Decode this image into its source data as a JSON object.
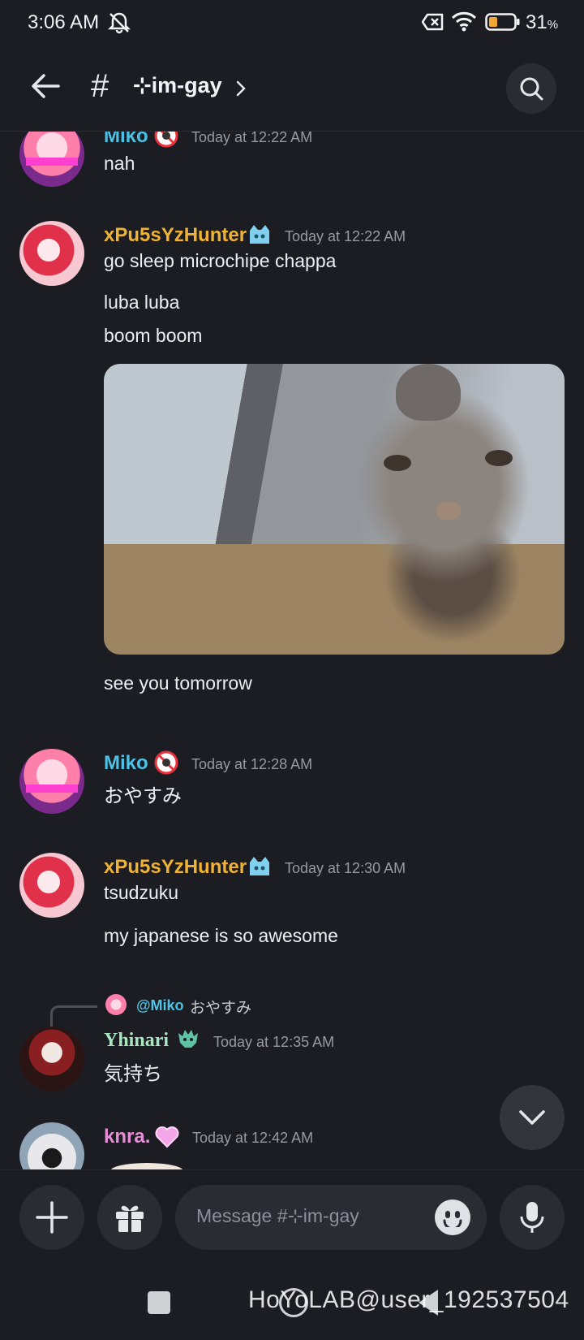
{
  "status_bar": {
    "time": "3:06 AM",
    "battery_pct": "31",
    "battery_unit": "%"
  },
  "header": {
    "hash": "#",
    "channel_name": "⊹im-gay",
    "chevron": "›"
  },
  "messages": [
    {
      "author": "Miko",
      "author_color": "#4cc3e6",
      "timestamp": "Today at 12:22 AM",
      "lines": [
        "nah"
      ]
    },
    {
      "author": "xPu5sYzHunter",
      "author_color": "#f0b232",
      "timestamp": "Today at 12:22 AM",
      "lines": [
        "go sleep microchipe chappa",
        "luba luba",
        "boom boom",
        "see you tomorrow"
      ]
    },
    {
      "author": "Miko",
      "author_color": "#4cc3e6",
      "timestamp": "Today at 12:28 AM",
      "lines": [
        "おやすみ"
      ]
    },
    {
      "author": "xPu5sYzHunter",
      "author_color": "#f0b232",
      "timestamp": "Today at 12:30 AM",
      "lines": [
        "tsudzuku",
        "my japanese is so awesome"
      ]
    },
    {
      "reply_to": "@Miko",
      "reply_text": "おやすみ",
      "author": "Yhinari",
      "author_color": "#a9e6c0",
      "timestamp": "Today at 12:35 AM",
      "lines": [
        "気持ち"
      ]
    },
    {
      "author": "knra.",
      "author_color": "#e58fd6",
      "timestamp": "Today at 12:42 AM",
      "lines": []
    }
  ],
  "composer": {
    "placeholder": "Message #⊹im-gay"
  },
  "watermark": "HoYoLAB@user_192537504",
  "colors": {
    "background": "#1c1d23",
    "surface": "#2b2c33",
    "timestamp": "#949ba4"
  }
}
